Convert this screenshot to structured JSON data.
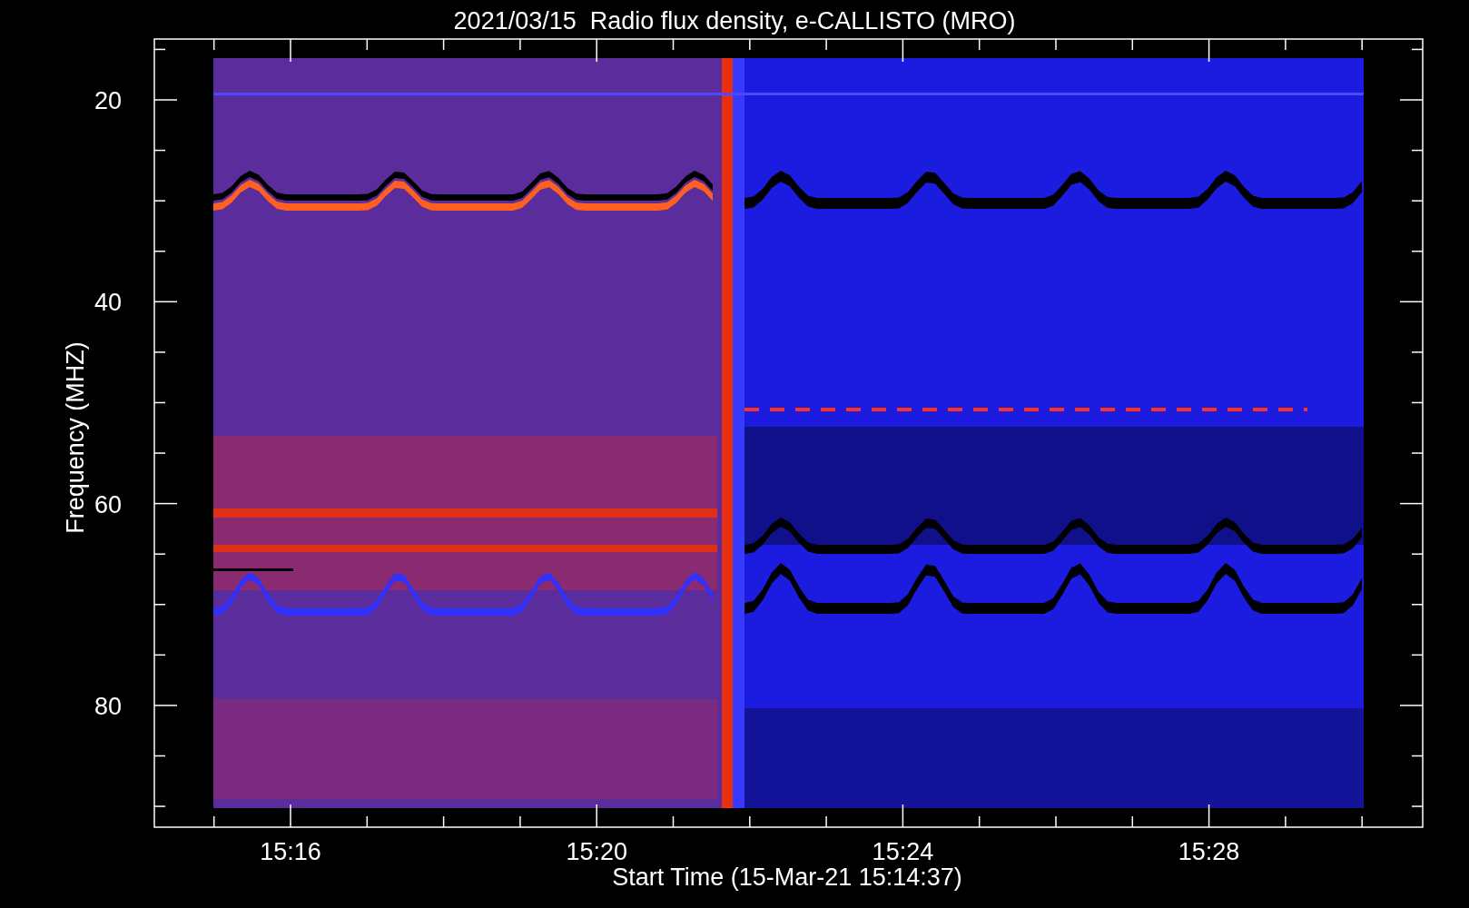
{
  "title": "2021/03/15  Radio flux density, e-CALLISTO (MRO)",
  "y_axis": {
    "label": "Frequency (MHZ)",
    "ticks": [
      "20",
      "40",
      "60",
      "80"
    ]
  },
  "x_axis": {
    "label": "Start Time (15-Mar-21 15:14:37)",
    "ticks": [
      "15:16",
      "15:20",
      "15:24",
      "15:28"
    ]
  }
}
